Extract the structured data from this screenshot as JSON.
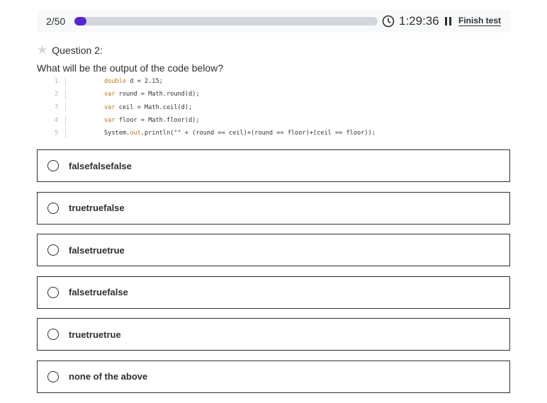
{
  "header": {
    "count": "2/50",
    "progress": 0.04,
    "time": "1:29:36",
    "finish_label": "Finish test",
    "accent": "#5624d0"
  },
  "question": {
    "heading": "Question 2:",
    "text": "What will be the output of the code below?"
  },
  "code": [
    {
      "n": "1",
      "seg": [
        [
          "double",
          "kw"
        ],
        [
          " d = 2.15;",
          ""
        ]
      ]
    },
    {
      "n": "2",
      "seg": [
        [
          "var",
          "kw"
        ],
        [
          " round = Math.round(d);",
          ""
        ]
      ]
    },
    {
      "n": "3",
      "seg": [
        [
          "var",
          "kw"
        ],
        [
          " ceil = Math.ceil(d);",
          ""
        ]
      ]
    },
    {
      "n": "4",
      "seg": [
        [
          "var",
          "kw"
        ],
        [
          " floor = Math.floor(d);",
          ""
        ]
      ]
    },
    {
      "n": "5",
      "seg": [
        [
          "System.",
          ""
        ],
        [
          "out",
          "kw"
        ],
        [
          ".println(\"\" + (round == ceil)+(round == floor)+(ceil == floor));",
          ""
        ]
      ]
    }
  ],
  "options": [
    "falsefalsefalse",
    "truetruefalse",
    "falsetruetrue",
    "falsetruefalse",
    "truetruetrue",
    "none of the above"
  ]
}
